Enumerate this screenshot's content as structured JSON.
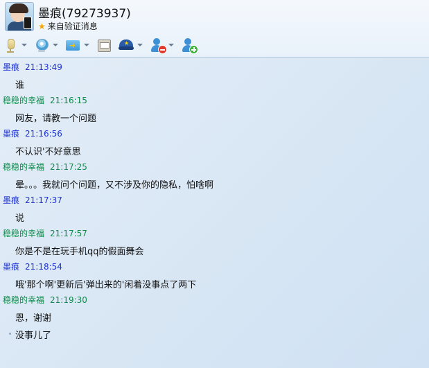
{
  "header": {
    "contact_name": "墨痕(79273937)",
    "status_text": "来自验证消息",
    "star_icon": "star-icon"
  },
  "toolbar": {
    "buttons": [
      {
        "icon": "microphone-icon",
        "has_dropdown": true
      },
      {
        "icon": "webcam-icon",
        "has_dropdown": true
      },
      {
        "icon": "send-file-icon",
        "has_dropdown": true
      },
      {
        "icon": "screen-share-icon",
        "has_dropdown": false
      },
      {
        "icon": "police-report-icon",
        "has_dropdown": true
      },
      {
        "icon": "remove-contact-icon",
        "has_dropdown": true
      },
      {
        "icon": "add-contact-icon",
        "has_dropdown": false
      }
    ]
  },
  "messages": [
    {
      "sender": "墨痕",
      "time": "21:13:49",
      "text": "谁",
      "is_self": true
    },
    {
      "sender": "稳稳的幸福",
      "time": "21:16:15",
      "text": "网友，请教一个问题",
      "is_self": false
    },
    {
      "sender": "墨痕",
      "time": "21:16:56",
      "text": "不认识'不好意思",
      "is_self": true
    },
    {
      "sender": "稳稳的幸福",
      "time": "21:17:25",
      "text": "晕。。。我就问个问题，又不涉及你的隐私，怕啥啊",
      "is_self": false
    },
    {
      "sender": "墨痕",
      "time": "21:17:37",
      "text": "说",
      "is_self": true
    },
    {
      "sender": "稳稳的幸福",
      "time": "21:17:57",
      "text": "你是不是在玩手机qq的假面舞会",
      "is_self": false
    },
    {
      "sender": "墨痕",
      "time": "21:18:54",
      "text": "哦'那个啊'更新后'弹出来的'闲着没事点了两下",
      "is_self": true
    },
    {
      "sender": "稳稳的幸福",
      "time": "21:19:30",
      "text": "恩，谢谢",
      "text2": "没事儿了",
      "is_self": false
    }
  ],
  "colors": {
    "self_name": "#1f34d1",
    "other_name": "#118a4b",
    "divider": "#a9c1db"
  }
}
